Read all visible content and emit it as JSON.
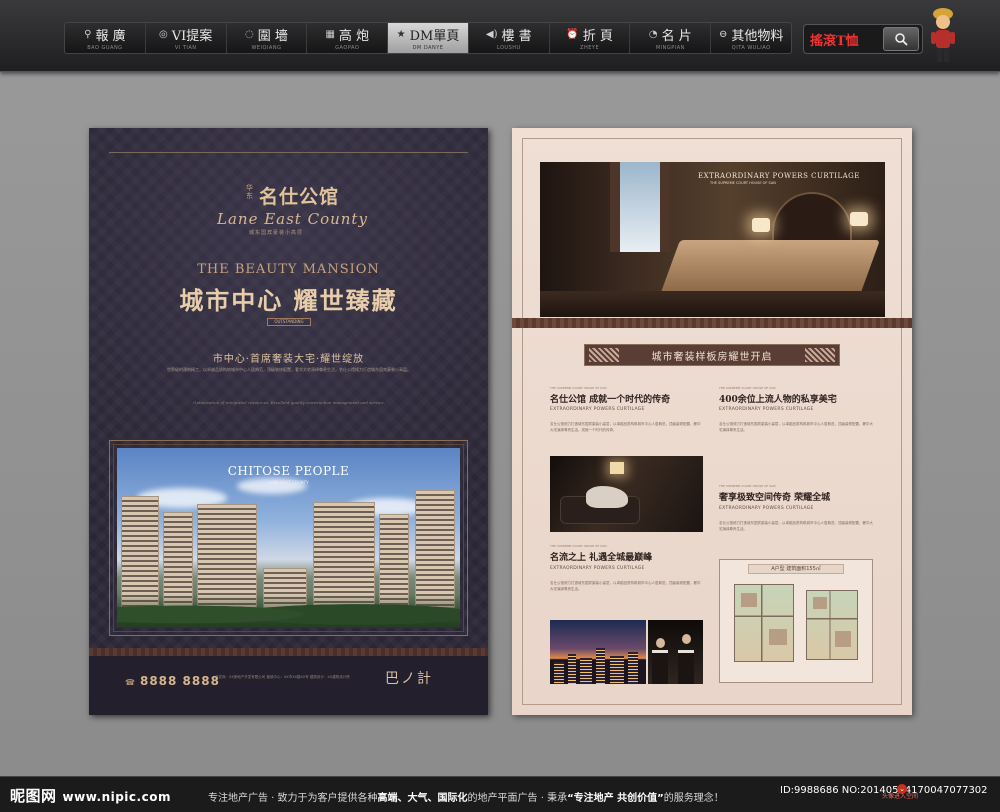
{
  "nav": {
    "items": [
      {
        "icon": "⚲",
        "icon_name": "pin-icon",
        "label": "報 廣",
        "sub": "BAO GUANG"
      },
      {
        "icon": "◎",
        "icon_name": "target-icon",
        "label": "VI提案",
        "sub": "VI TIAN"
      },
      {
        "icon": "◌",
        "icon_name": "circle-icon",
        "label": "圍 墻",
        "sub": "WEIQIANG"
      },
      {
        "icon": "▦",
        "icon_name": "grid-icon",
        "label": "高 炮",
        "sub": "GAOPAO"
      },
      {
        "icon": "★",
        "icon_name": "star-icon",
        "label": "DM單頁",
        "sub": "DM DANYE",
        "active": true
      },
      {
        "icon": "◀)",
        "icon_name": "speaker-icon",
        "label": "樓 書",
        "sub": "LOUSHU"
      },
      {
        "icon": "⏰",
        "icon_name": "clock-icon",
        "label": "折 頁",
        "sub": "ZHEYE"
      },
      {
        "icon": "◔",
        "icon_name": "pie-icon",
        "label": "名 片",
        "sub": "MINGPIAN"
      },
      {
        "icon": "⊖",
        "icon_name": "minus-circle-icon",
        "label": "其他物料",
        "sub": "QITA WULIAO"
      }
    ]
  },
  "search": {
    "label": "搖滾T恤",
    "icon_name": "magnifier-icon"
  },
  "left_page": {
    "brand_small": "华东",
    "brand_name": "名仕公馆",
    "brand_en": "Lane East County",
    "brand_tag": "城东国宾豪装小高层",
    "headline_en": "THE BEAUTY MANSION",
    "headline_cn": "城市中心 耀世臻藏",
    "badge": "OUTSTANDING",
    "subtitle": "市中心·首席奢装大宅·耀世绽放",
    "para": "世界级的建筑精工，以卓越品质构筑城市中心人居典范，顶级装修配置，奢华大宅演绎尊贵生活，名仕公馆倾力打造城东国宾豪装小高层。",
    "italic": "Optimization of integrated resources. Excellent quality construction management and service.",
    "photo_title": "CHITOSE PEOPLE",
    "photo_sub": "LANE EAST COUNTY",
    "phone": "8888 8888",
    "footer_small": "开发商：XX房地产开发有限公司 营销中心：XX市XX路XX号 建筑设计：XX建筑设计院",
    "footer_logo": "巴ノ計"
  },
  "right_page": {
    "bedroom_caption": "EXTRAORDINARY POWERS CURTILAGE",
    "bedroom_caption_sub": "THE SUPREME COURT HOUSE OF SAN",
    "ribbon": "城市奢装样板房耀世开启",
    "sections": [
      {
        "title": "名仕公馆 成就一个时代的传奇",
        "tiny": "THE SUPREME COURT HOUSE OF SAN",
        "sub": "EXTRAORDINARY POWERS CURTILAGE",
        "body": "名仕公馆倾力打造城东国宾豪装小高层，以卓越品质构筑城市中心人居典范，顶级装修配置，奢华大宅演绎尊贵生活，成就一个时代的传奇。"
      },
      {
        "title": "400余位上流人物的私享美宅",
        "tiny": "THE SUPREME COURT HOUSE OF SAN",
        "sub": "EXTRAORDINARY POWERS CURTILAGE",
        "body": "名仕公馆倾力打造城东国宾豪装小高层，以卓越品质构筑城市中心人居典范，顶级装修配置，奢华大宅演绎尊贵生活。"
      },
      {
        "title": "奢享极致空间传奇 荣耀全城",
        "tiny": "THE SUPREME COURT HOUSE OF SAN",
        "sub": "EXTRAORDINARY POWERS CURTILAGE",
        "body": "名仕公馆倾力打造城东国宾豪装小高层，以卓越品质构筑城市中心人居典范，顶级装修配置，奢华大宅演绎尊贵生活。"
      },
      {
        "title": "名流之上 礼遇全城最巅峰",
        "tiny": "THE SUPREME COURT HOUSE OF SAN",
        "sub": "EXTRAORDINARY POWERS CURTILAGE",
        "body": "名仕公馆倾力打造城东国宾豪装小高层，以卓越品质构筑城市中心人居典范，顶级装修配置，奢华大宅演绎尊贵生活。"
      }
    ],
    "plan_label": "A户型  建筑面积155㎡"
  },
  "bottom": {
    "logo": "昵图网",
    "url": "www.nipic.com",
    "slogan_prefix": "专注地产广告 · 致力于为客户提供各种",
    "slogan_hl1": "高端、大气、国际化",
    "slogan_mid": "的地产平面广告 · 秉承",
    "slogan_hl2": "“专注地产 共创价值”",
    "slogan_suffix": "的服务理念！",
    "id_text": "ID:9988686 NO:20140504170047077302",
    "enter_label": "头像进入空间"
  },
  "colors": {
    "accent_red": "#e33333",
    "gold": "#d9b88f",
    "dark_page": "#2a2635",
    "light_page": "#efdfd5"
  }
}
